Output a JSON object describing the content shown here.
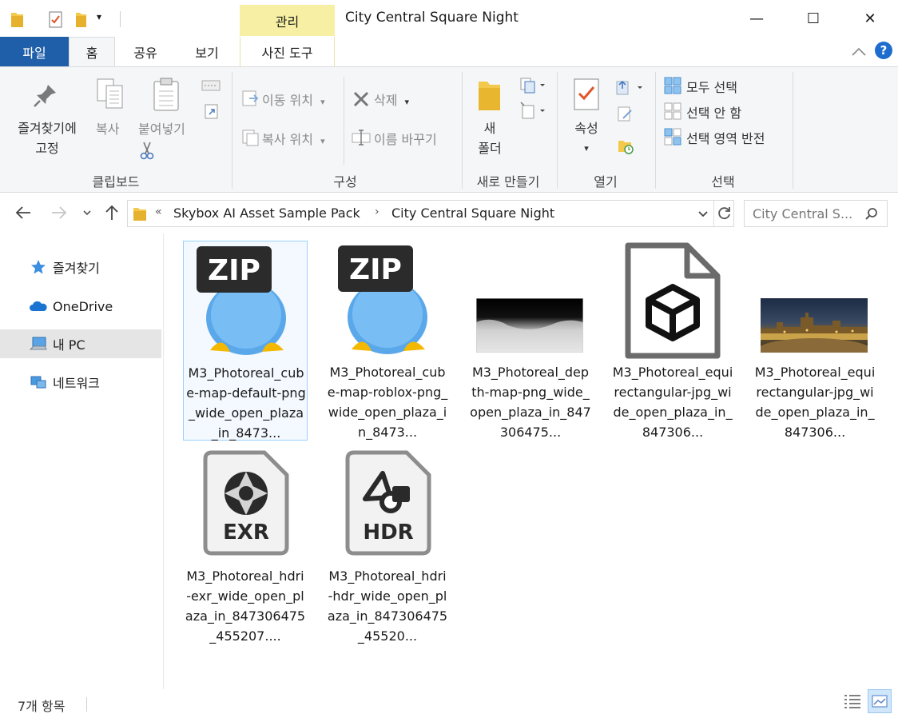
{
  "window": {
    "title": "City Central Square Night",
    "context_group": "관리",
    "min": "—",
    "max": "☐",
    "close": "✕"
  },
  "quick_access": {
    "caret": "▾"
  },
  "tabs": {
    "file": "파일",
    "home": "홈",
    "share": "공유",
    "view": "보기",
    "photo_tools": "사진 도구"
  },
  "ribbon": {
    "clipboard": {
      "pin_line1": "즐겨찾기에",
      "pin_line2": "고정",
      "copy": "복사",
      "paste": "붙여넣기",
      "label": "클립보드"
    },
    "organize": {
      "move_to": "이동 위치",
      "copy_to": "복사 위치",
      "delete": "삭제",
      "rename": "이름 바꾸기",
      "label": "구성"
    },
    "new": {
      "folder_line1": "새",
      "folder_line2": "폴더",
      "label": "새로 만들기"
    },
    "open": {
      "properties": "속성",
      "label": "열기"
    },
    "select": {
      "select_all": "모두 선택",
      "select_none": "선택 안 함",
      "invert": "선택 영역 반전",
      "label": "선택"
    }
  },
  "address": {
    "overflow": "«",
    "crumbs": [
      "Skybox AI Asset Sample Pack",
      "City Central Square Night"
    ],
    "search_placeholder": "City Central S..."
  },
  "nav": {
    "items": [
      {
        "label": "즐겨찾기"
      },
      {
        "label": "OneDrive"
      },
      {
        "label": "내 PC"
      },
      {
        "label": "네트워크"
      }
    ]
  },
  "files": [
    {
      "name": "M3_Photoreal_cube-map-default-png_wide_open_plaza_in_8473...",
      "type": "zip",
      "badge": "ZIP"
    },
    {
      "name": "M3_Photoreal_cube-map-roblox-png_wide_open_plaza_in_8473...",
      "type": "zip",
      "badge": "ZIP"
    },
    {
      "name": "M3_Photoreal_depth-map-png_wide_open_plaza_in_847306475...",
      "type": "depth"
    },
    {
      "name": "M3_Photoreal_equirectangular-jpg_wide_open_plaza_in_847306...",
      "type": "3d"
    },
    {
      "name": "M3_Photoreal_equirectangular-jpg_wide_open_plaza_in_847306...",
      "type": "photo"
    },
    {
      "name": "M3_Photoreal_hdri-exr_wide_open_plaza_in_847306475_455207....",
      "type": "exr",
      "badge": "EXR"
    },
    {
      "name": "M3_Photoreal_hdri-hdr_wide_open_plaza_in_847306475_45520...",
      "type": "hdr",
      "badge": "HDR"
    }
  ],
  "status": {
    "count": "7개 항목"
  }
}
